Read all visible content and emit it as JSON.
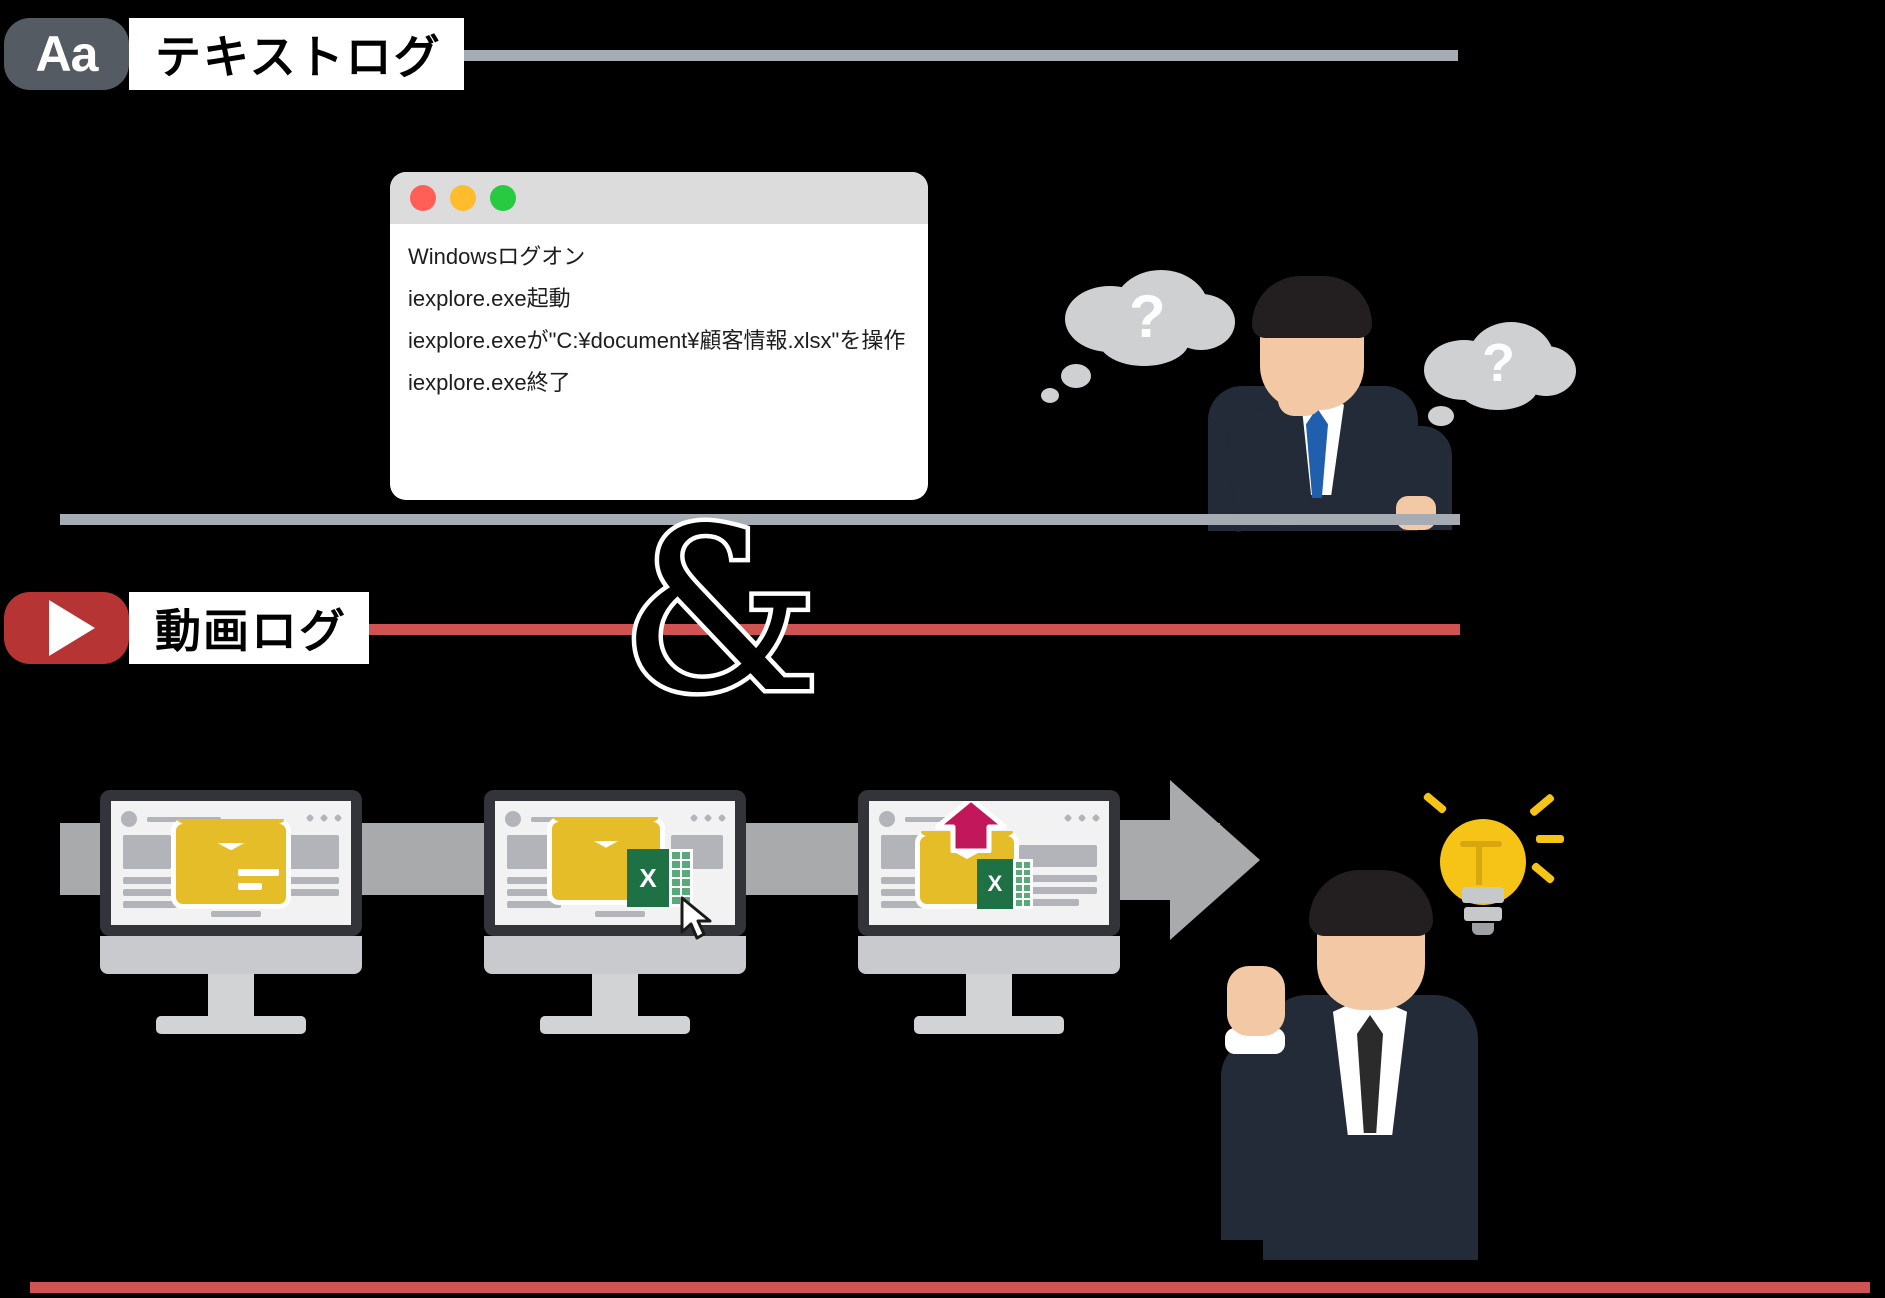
{
  "sections": {
    "text_log": {
      "badge_label": "Aa",
      "badge_icon": "text-format-icon",
      "title": "テキストログ",
      "rule_color": "#a7abb4"
    },
    "video_log": {
      "badge_icon": "play-button-icon",
      "title": "動画ログ",
      "rule_color": "#cf5353"
    }
  },
  "conjunction": {
    "symbol": "&"
  },
  "log_window": {
    "traffic_lights": [
      "close",
      "minimize",
      "maximize"
    ],
    "lines": [
      "Windowsログオン",
      "iexplore.exe起動",
      "iexplore.exeが\"C:¥document¥顧客情報.xlsx\"を操作",
      "iexplore.exe終了"
    ]
  },
  "thought_bubbles": {
    "marks": [
      "?",
      "?"
    ]
  },
  "workflow": {
    "steps": [
      {
        "name": "mail-screen",
        "icons": [
          "envelope"
        ]
      },
      {
        "name": "mail-attach-excel-screen",
        "icons": [
          "envelope",
          "excel",
          "cursor"
        ]
      },
      {
        "name": "mail-upload-excel-screen",
        "icons": [
          "envelope",
          "excel",
          "upload-arrow"
        ]
      }
    ],
    "arrow": "right-arrow",
    "arrow_color": "#a9aaac"
  },
  "people": {
    "confused": {
      "name": "confused-businessman",
      "state": "thinking"
    },
    "confident": {
      "name": "confident-businessman",
      "state": "idea"
    }
  },
  "colors": {
    "badge_gray": "#555b63",
    "badge_red": "#b63434",
    "envelope_yellow": "#e5bd28",
    "excel_green": "#1e7145",
    "upload_red": "#c2185b",
    "bulb_yellow": "#f5c417",
    "background": "#000000"
  }
}
